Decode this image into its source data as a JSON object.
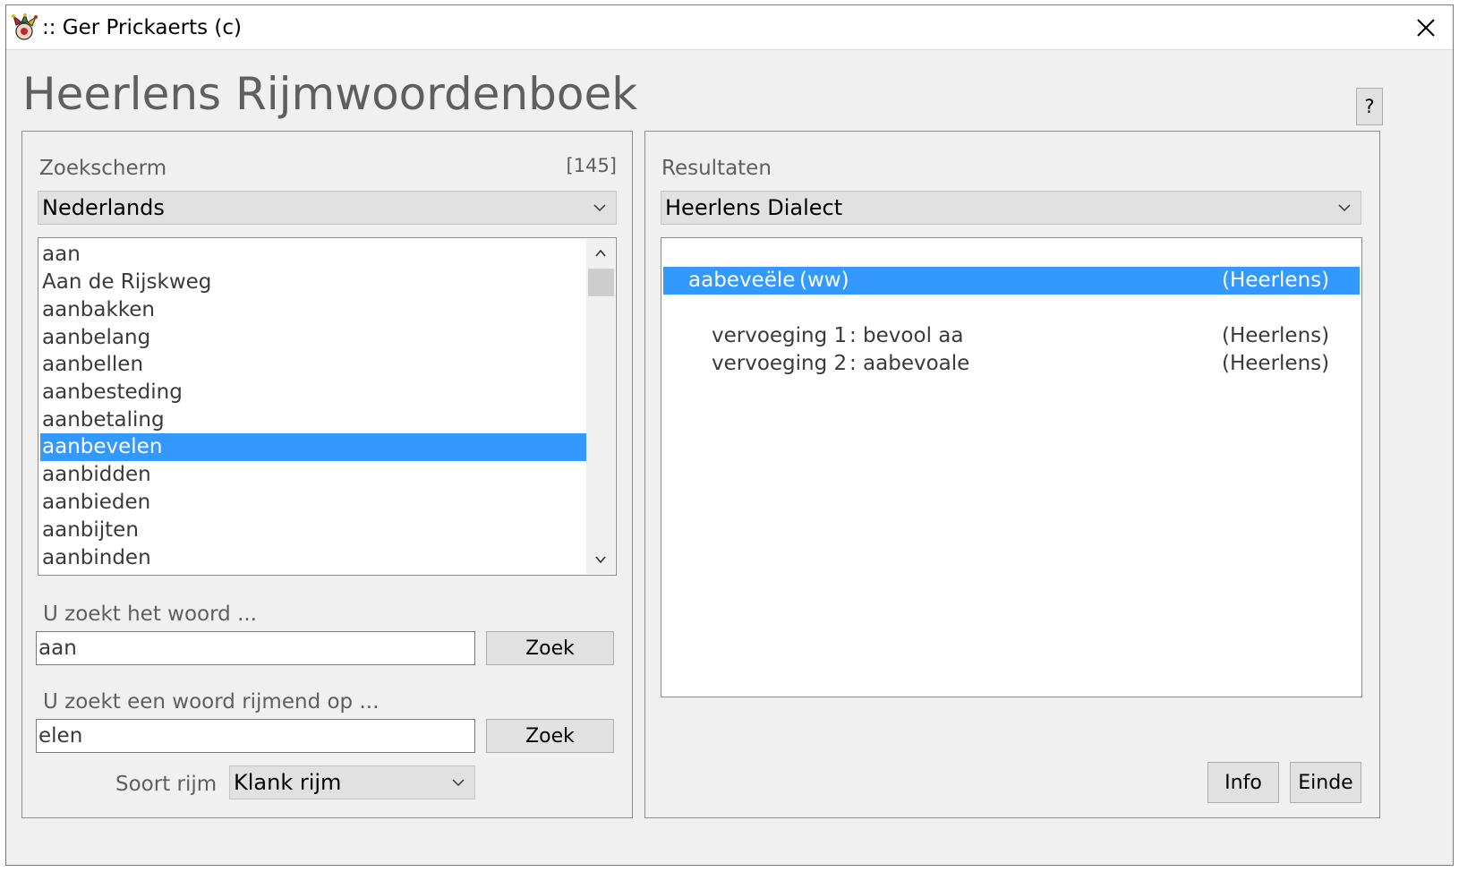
{
  "window": {
    "title": ":: Ger Prickaerts (c)",
    "app_title": "Heerlens Rijmwoordenboek",
    "help_label": "?"
  },
  "search_panel": {
    "label": "Zoekscherm",
    "count": "[145]",
    "language": "Nederlands",
    "words": [
      "aan",
      "Aan de Rijskweg",
      "aanbakken",
      "aanbelang",
      "aanbellen",
      "aanbesteding",
      "aanbetaling",
      "aanbevelen",
      "aanbidden",
      "aanbieden",
      "aanbijten",
      "aanbinden"
    ],
    "selected_word": "aanbevelen",
    "word_search": {
      "label": "U zoekt het woord ...",
      "value": "aan",
      "button": "Zoek"
    },
    "rhyme_search": {
      "label": "U zoekt een woord rijmend op ...",
      "value": "elen",
      "button": "Zoek"
    },
    "rhyme_type": {
      "label": "Soort rijm",
      "value": "Klank rijm"
    }
  },
  "results_panel": {
    "label": "Resultaten",
    "dialect": "Heerlens Dialect",
    "main_entry": {
      "word": "aabeveële",
      "type": "(ww)",
      "source": "(Heerlens)"
    },
    "conjugations": [
      {
        "label": "vervoeging 1",
        "value": ": bevool aa",
        "source": "(Heerlens)"
      },
      {
        "label": "vervoeging 2",
        "value": ": aabevoale",
        "source": "(Heerlens)"
      }
    ],
    "info_button": "Info",
    "exit_button": "Einde"
  },
  "colors": {
    "selection": "#3399ff",
    "window_bg": "#f0f0f0",
    "button_bg": "#e1e1e1"
  },
  "icons": [
    "jester-app-icon",
    "close-icon",
    "chevron-down-icon",
    "chevron-up-icon"
  ]
}
